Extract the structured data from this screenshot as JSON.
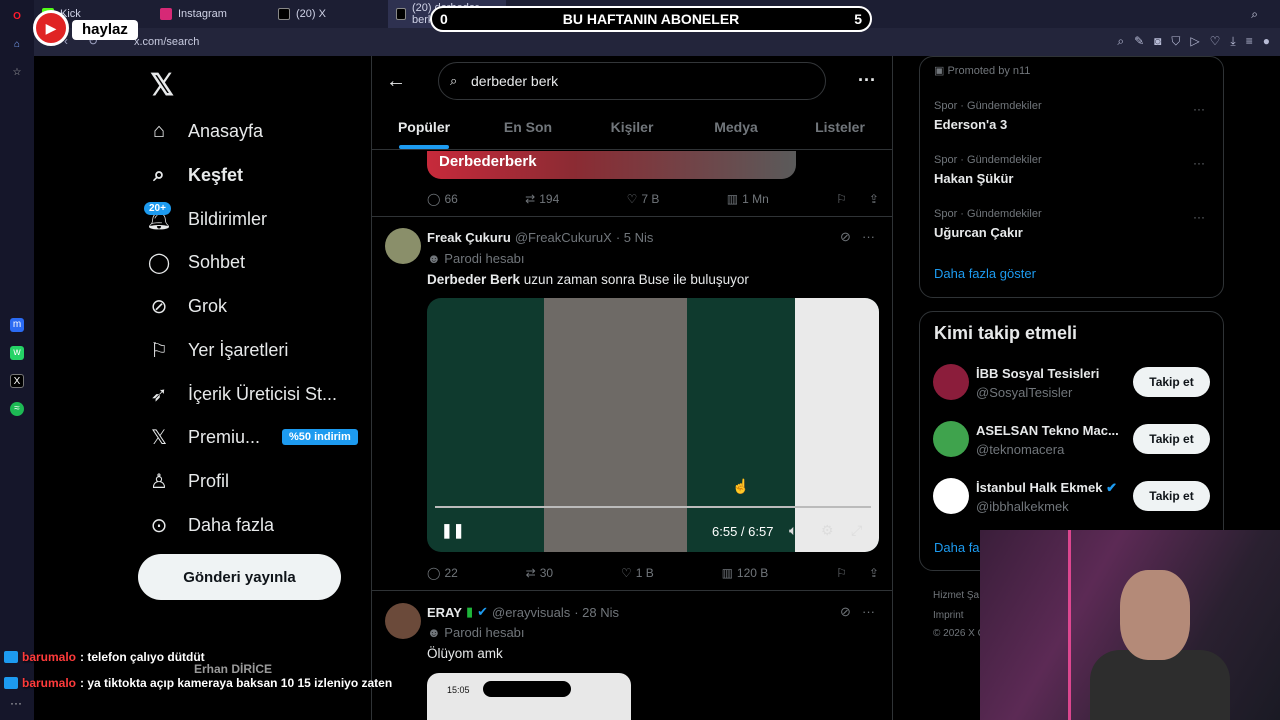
{
  "browser": {
    "tabs": [
      "Kick",
      "Instagram",
      "(20) X",
      "(20) derbeder berk - X"
    ],
    "address": "x.com/search"
  },
  "stream": {
    "channel_name": "haylaz",
    "banner_left": "0",
    "banner_title": "BU HAFTANIN ABONELER",
    "banner_right": "5"
  },
  "nav": {
    "items": [
      "Anasayfa",
      "Keşfet",
      "Bildirimler",
      "Sohbet",
      "Grok",
      "Yer İşaretleri",
      "İçerik Üreticisi St...",
      "Premiu...",
      "Profil",
      "Daha fazla"
    ],
    "notif_badge": "20+",
    "premium_badge": "%50 indirim",
    "post_button": "Gönderi yayınla"
  },
  "search": {
    "query": "derbeder berk",
    "tabs": [
      "Popüler",
      "En Son",
      "Kişiler",
      "Medya",
      "Listeler"
    ]
  },
  "prev_tweet": {
    "media_text": "Derbederberk",
    "replies": "66",
    "reposts": "194",
    "likes": "7 B",
    "views": "1 Mn"
  },
  "tweet1": {
    "name": "Freak Çukuru",
    "handle": "@FreakCukuruX",
    "date": "· 5 Nis",
    "label": "Parodi hesabı",
    "text_bold": "Derbeder Berk",
    "text_rest": " uzun zaman sonra Buse ile buluşuyor",
    "video_time": "6:55 / 6:57",
    "replies": "22",
    "reposts": "30",
    "likes": "1 B",
    "views": "120 B"
  },
  "tweet2": {
    "name": "ERAY",
    "handle": "@erayvisuals",
    "date": "· 28 Nis",
    "label": "Parodi hesabı",
    "text": "Ölüyom amk",
    "phone_time": "15:05"
  },
  "sidebar": {
    "promoted": "Promoted by n11",
    "trends": [
      {
        "meta": "Spor · Gündemdekiler",
        "name": "Ederson'a 3"
      },
      {
        "meta": "Spor · Gündemdekiler",
        "name": "Hakan Şükür"
      },
      {
        "meta": "Spor · Gündemdekiler",
        "name": "Uğurcan Çakır"
      }
    ],
    "show_more": "Daha fazla göster",
    "who_to_follow": "Kimi takip etmeli",
    "suggestions": [
      {
        "name": "İBB Sosyal Tesisleri",
        "handle": "@SosyalTesisler"
      },
      {
        "name": "ASELSAN Tekno Mac...",
        "handle": "@teknomacera"
      },
      {
        "name": "İstanbul Halk Ekmek",
        "handle": "@ibbhalkekmek"
      }
    ],
    "follow_label": "Takip et",
    "show_more_2": "Daha fa",
    "footer": [
      "Hizmet Şa",
      "Imprint",
      "© 2026 X C"
    ]
  },
  "chat": [
    {
      "user": "barumalo",
      "message": ": telefon çalıyo dütdüt"
    },
    {
      "user": "barumalo",
      "message": ": ya tiktokta açıp kameraya baksan 10 15 izleniyo zaten"
    }
  ],
  "overlay_name": "Erhan DİRİCE",
  "colors": {
    "accent": "#1d9bf0",
    "bg": "#000000",
    "text": "#e7e9ea",
    "muted": "#71767b"
  }
}
